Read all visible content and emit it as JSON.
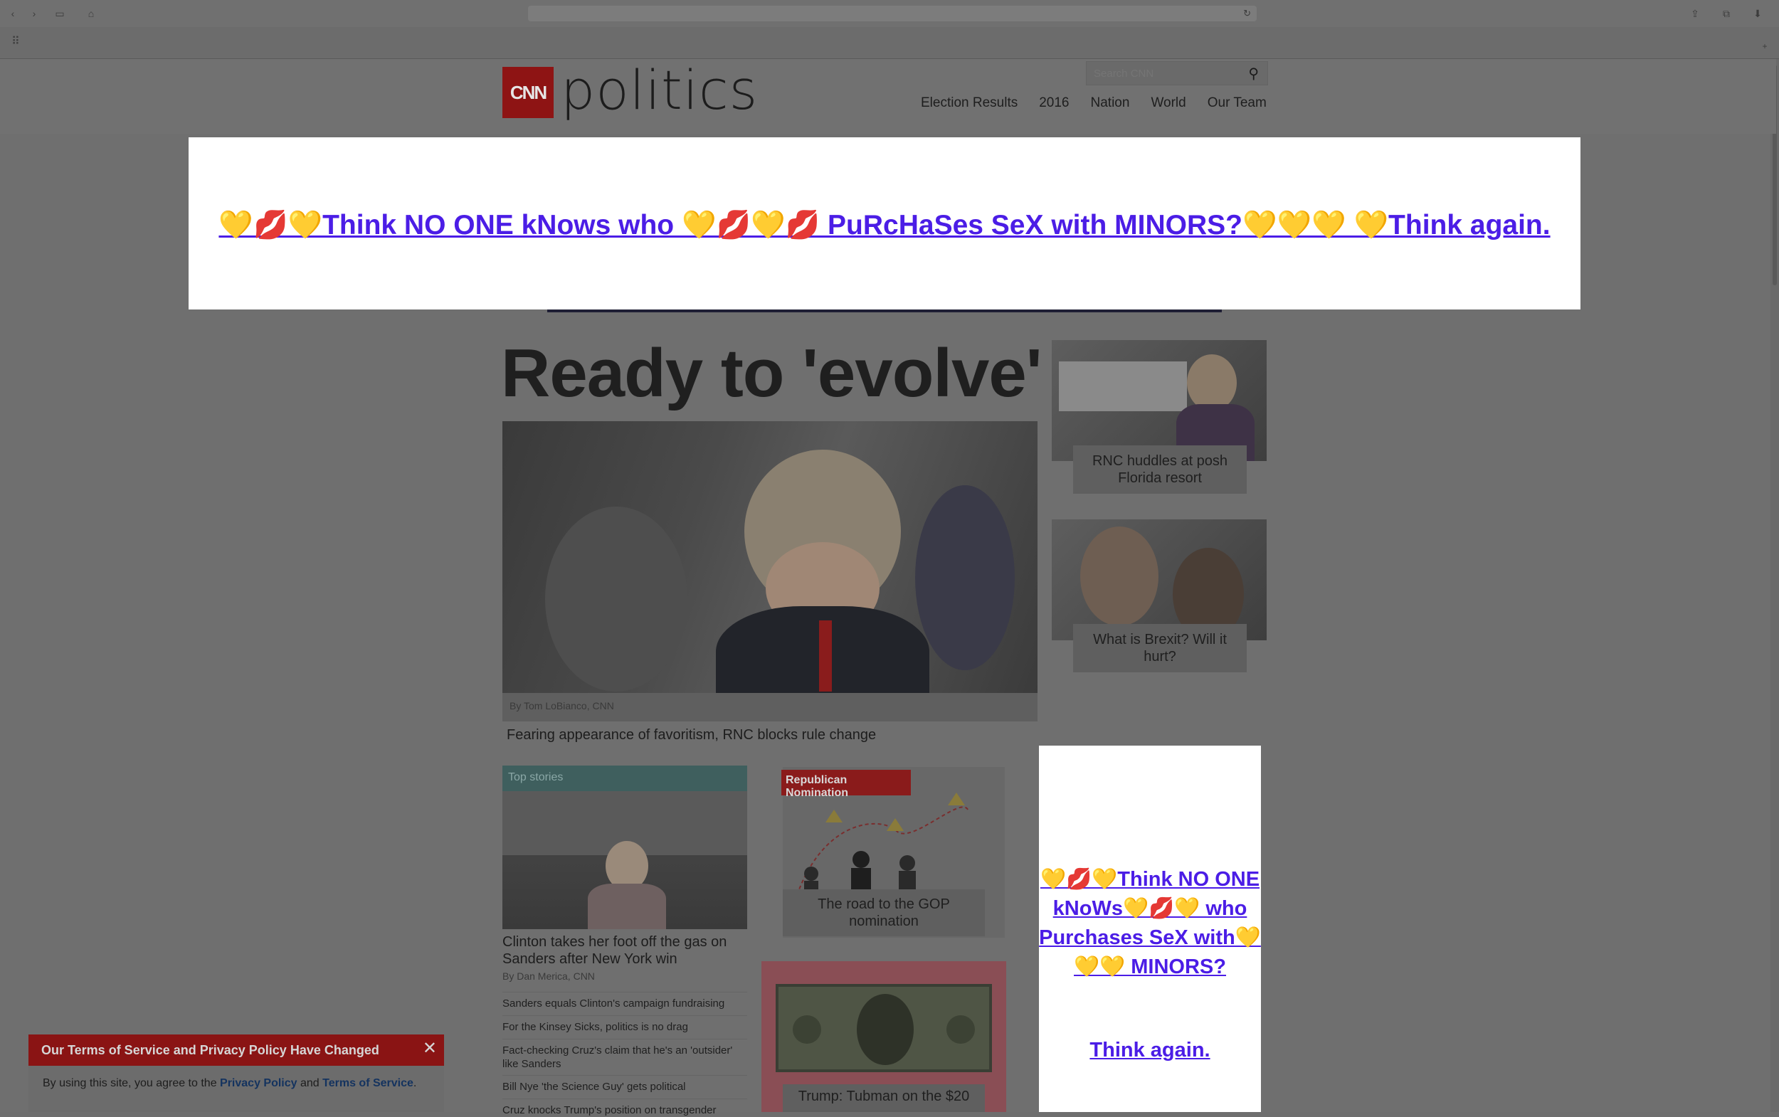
{
  "browser": {
    "back_glyph": "‹",
    "forward_glyph": "›",
    "sidebar_glyph": "▭",
    "home_glyph": "⌂",
    "reload_glyph": "↻",
    "share_glyph": "⇪",
    "tabs_glyph": "⧉",
    "download_glyph": "⬇",
    "apps_glyph": "⠿",
    "plus_glyph": "+"
  },
  "header": {
    "logo_text": "CNN",
    "section_word": "politics",
    "search_placeholder": "Search CNN",
    "nav": [
      "Election Results",
      "2016",
      "Nation",
      "World",
      "Our Team"
    ]
  },
  "ads": {
    "top_text": "💛💋💛Think NO ONE kNows who 💛💋💛💋 PuRcHaSes SeX with MINORS?💛💛💛 💛Think again.",
    "right_text": "💛💋💛Think NO ONE kNoWs💛💋💛 who Purchases SeX with💛💛💛 MINORS?",
    "right_text2": "Think again."
  },
  "hero": {
    "headline": "Ready to 'evolve'",
    "credit": "By Tom LoBianco, CNN",
    "subhead": "Fearing appearance of favoritism, RNC blocks rule change"
  },
  "side_stories": [
    {
      "caption": "RNC huddles at posh Florida resort"
    },
    {
      "caption": "What is Brexit? Will it hurt?"
    }
  ],
  "top_stories": {
    "label": "Top stories",
    "headline": "Clinton takes her foot off the gas on Sanders after New York win",
    "byline": "By Dan Merica, CNN",
    "items": [
      "Sanders equals Clinton's campaign fundraising",
      "For the Kinsey Sicks, politics is no drag",
      "Fact-checking Cruz's claim that he's an 'outsider' like Sanders",
      "Bill Nye 'the Science Guy' gets political",
      "Cruz knocks Trump's position on transgender"
    ]
  },
  "gop": {
    "badge": "Republican Nomination",
    "caption": "The road to the GOP nomination"
  },
  "tubman": {
    "caption": "Trump: Tubman on the $20"
  },
  "tos": {
    "title": "Our Terms of Service and Privacy Policy Have Changed",
    "close_glyph": "✕",
    "text_pre": "By using this site, you agree to the ",
    "privacy": "Privacy Policy",
    "and": " and ",
    "terms": "Terms of Service",
    "end": "."
  }
}
